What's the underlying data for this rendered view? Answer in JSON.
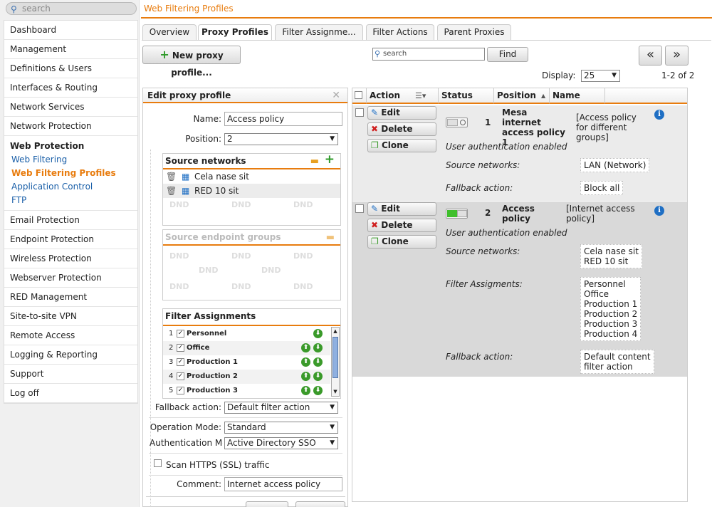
{
  "search": {
    "placeholder": "search"
  },
  "nav": {
    "dashboard": "Dashboard",
    "management": "Management",
    "definitions": "Definitions & Users",
    "interfaces": "Interfaces & Routing",
    "network_services": "Network Services",
    "network_protection": "Network Protection",
    "web_protection": "Web Protection",
    "web_filtering": "Web Filtering",
    "web_filtering_profiles": "Web Filtering Profiles",
    "application_control": "Application Control",
    "ftp": "FTP",
    "email_protection": "Email Protection",
    "endpoint_protection": "Endpoint Protection",
    "wireless_protection": "Wireless Protection",
    "webserver_protection": "Webserver Protection",
    "red_management": "RED Management",
    "site_to_site": "Site-to-site VPN",
    "remote_access": "Remote Access",
    "logging": "Logging & Reporting",
    "support": "Support",
    "logoff": "Log off"
  },
  "page_title": "Web Filtering Profiles",
  "tabs": [
    "Overview",
    "Proxy Profiles",
    "Filter Assignme...",
    "Filter Actions",
    "Parent Proxies"
  ],
  "toolbar": {
    "new_button": "New proxy profile...",
    "search_placeholder": "search",
    "find": "Find",
    "prev": "«",
    "next": "»",
    "display_label": "Display:",
    "display_value": "25",
    "range": "1-2 of 2"
  },
  "edit": {
    "title": "Edit proxy profile",
    "name_label": "Name:",
    "name_value": "Access policy",
    "position_label": "Position:",
    "position_value": "2",
    "source_networks_title": "Source networks",
    "source_networks": [
      "Cela nase sit",
      "RED 10 sit"
    ],
    "dnd": "DND",
    "endpoint_title": "Source endpoint groups",
    "filter_assign_title": "Filter Assignments",
    "filter_assignments": [
      {
        "num": "1",
        "label": "Personnel"
      },
      {
        "num": "2",
        "label": "Office"
      },
      {
        "num": "3",
        "label": "Production 1"
      },
      {
        "num": "4",
        "label": "Production 2"
      },
      {
        "num": "5",
        "label": "Production 3"
      }
    ],
    "fallback_label": "Fallback action:",
    "fallback_value": "Default filter action",
    "opmode_label": "Operation Mode:",
    "opmode_value": "Standard",
    "auth_label": "Authentication Mod",
    "auth_value": "Active Directory SSO",
    "scan_https": "Scan HTTPS (SSL) traffic",
    "comment_label": "Comment:",
    "comment_value": "Internet access policy"
  },
  "grid": {
    "headers": {
      "action": "Action",
      "status": "Status",
      "position": "Position",
      "name": "Name"
    },
    "edit": "Edit",
    "delete": "Delete",
    "clone": "Clone",
    "user_auth": "User authentication enabled",
    "source_networks_label": "Source networks:",
    "fallback_label": "Fallback action:",
    "filter_assign_label": "Filter Assigments:",
    "rows": [
      {
        "position": "1",
        "name": "Mesa internet access policy 1",
        "comment": "[Access policy for different groups]",
        "source_networks": "LAN (Network)",
        "fallback": "Block all"
      },
      {
        "position": "2",
        "name": "Access policy",
        "comment": "[Internet access policy]",
        "source_networks": [
          "Cela nase sit",
          "RED 10 sit"
        ],
        "filter_assignments": [
          "Personnel",
          "Office",
          "Production 1",
          "Production 2",
          "Production 3",
          "Production 4"
        ],
        "fallback": [
          "Default content",
          "filter action"
        ]
      }
    ]
  }
}
